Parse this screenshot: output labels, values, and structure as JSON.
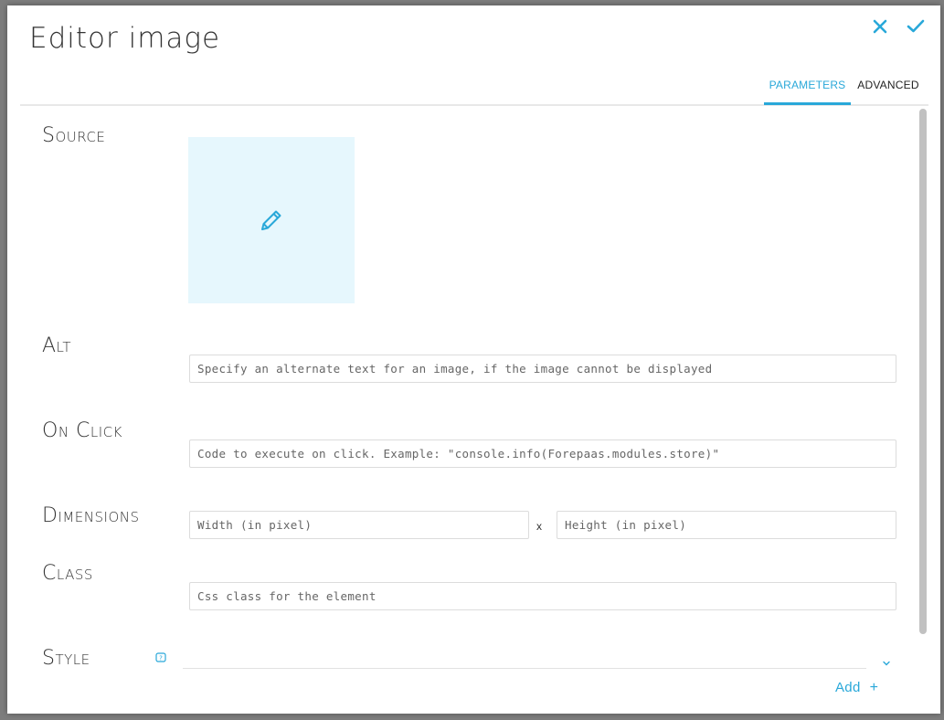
{
  "dialog": {
    "title": "Editor image"
  },
  "header": {
    "close_icon": "close-icon",
    "confirm_icon": "check-icon"
  },
  "tabs": [
    {
      "label": "PARAMETERS",
      "active": true
    },
    {
      "label": "ADVANCED",
      "active": false
    }
  ],
  "fields": {
    "source": {
      "label": "Source",
      "icon": "pencil-icon"
    },
    "alt": {
      "label": "Alt",
      "value": "",
      "placeholder": "Specify an alternate text for an image, if the image cannot be displayed"
    },
    "onclick": {
      "label": "On Click",
      "value": "",
      "placeholder": "Code to execute on click. Example: \"console.info(Forepaas.modules.store)\""
    },
    "dimensions": {
      "label": "Dimensions",
      "width_placeholder": "Width (in pixel)",
      "height_placeholder": "Height (in pixel)",
      "separator": "x"
    },
    "class": {
      "label": "Class",
      "value": "",
      "placeholder": "Css class for the element"
    },
    "style": {
      "label": "Style",
      "help_icon": "help-icon",
      "add_label": "Add",
      "add_icon": "+"
    }
  },
  "colors": {
    "accent": "#29a8d9",
    "image_placeholder_bg": "#e6f7fd"
  }
}
